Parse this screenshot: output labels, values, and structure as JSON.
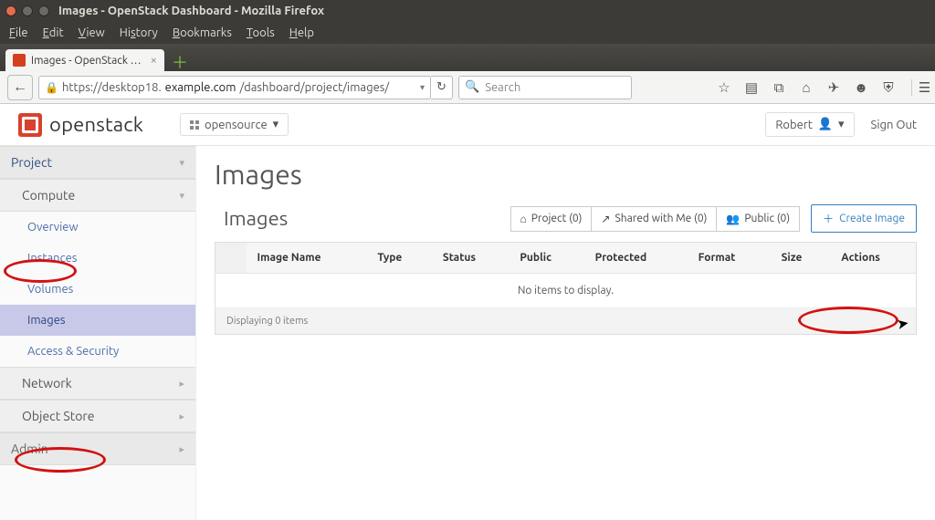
{
  "window": {
    "title": "Images - OpenStack Dashboard - Mozilla Firefox"
  },
  "menus": {
    "file": "File",
    "edit": "Edit",
    "view": "View",
    "history": "History",
    "bookmarks": "Bookmarks",
    "tools": "Tools",
    "help": "Help"
  },
  "tab": {
    "title": "Images - OpenStack …"
  },
  "url": {
    "prefix": "https://desktop18.",
    "host": "example.com",
    "path": "/dashboard/project/images/"
  },
  "search": {
    "placeholder": "Search"
  },
  "brand": {
    "name": "openstack"
  },
  "project_switcher": {
    "label": "opensource"
  },
  "user": {
    "name": "Robert"
  },
  "signout": "Sign Out",
  "sidebar": {
    "project": "Project",
    "compute": "Compute",
    "items": [
      "Overview",
      "Instances",
      "Volumes",
      "Images",
      "Access & Security"
    ],
    "network": "Network",
    "object_store": "Object Store",
    "admin": "Admin"
  },
  "page": {
    "title": "Images",
    "section": "Images",
    "filters": {
      "project": "Project (0)",
      "shared": "Shared with Me (0)",
      "public": "Public (0)"
    },
    "create": "Create Image",
    "columns": [
      "",
      "Image Name",
      "Type",
      "Status",
      "Public",
      "Protected",
      "Format",
      "Size",
      "Actions"
    ],
    "empty": "No items to display.",
    "footer": "Displaying 0 items"
  }
}
